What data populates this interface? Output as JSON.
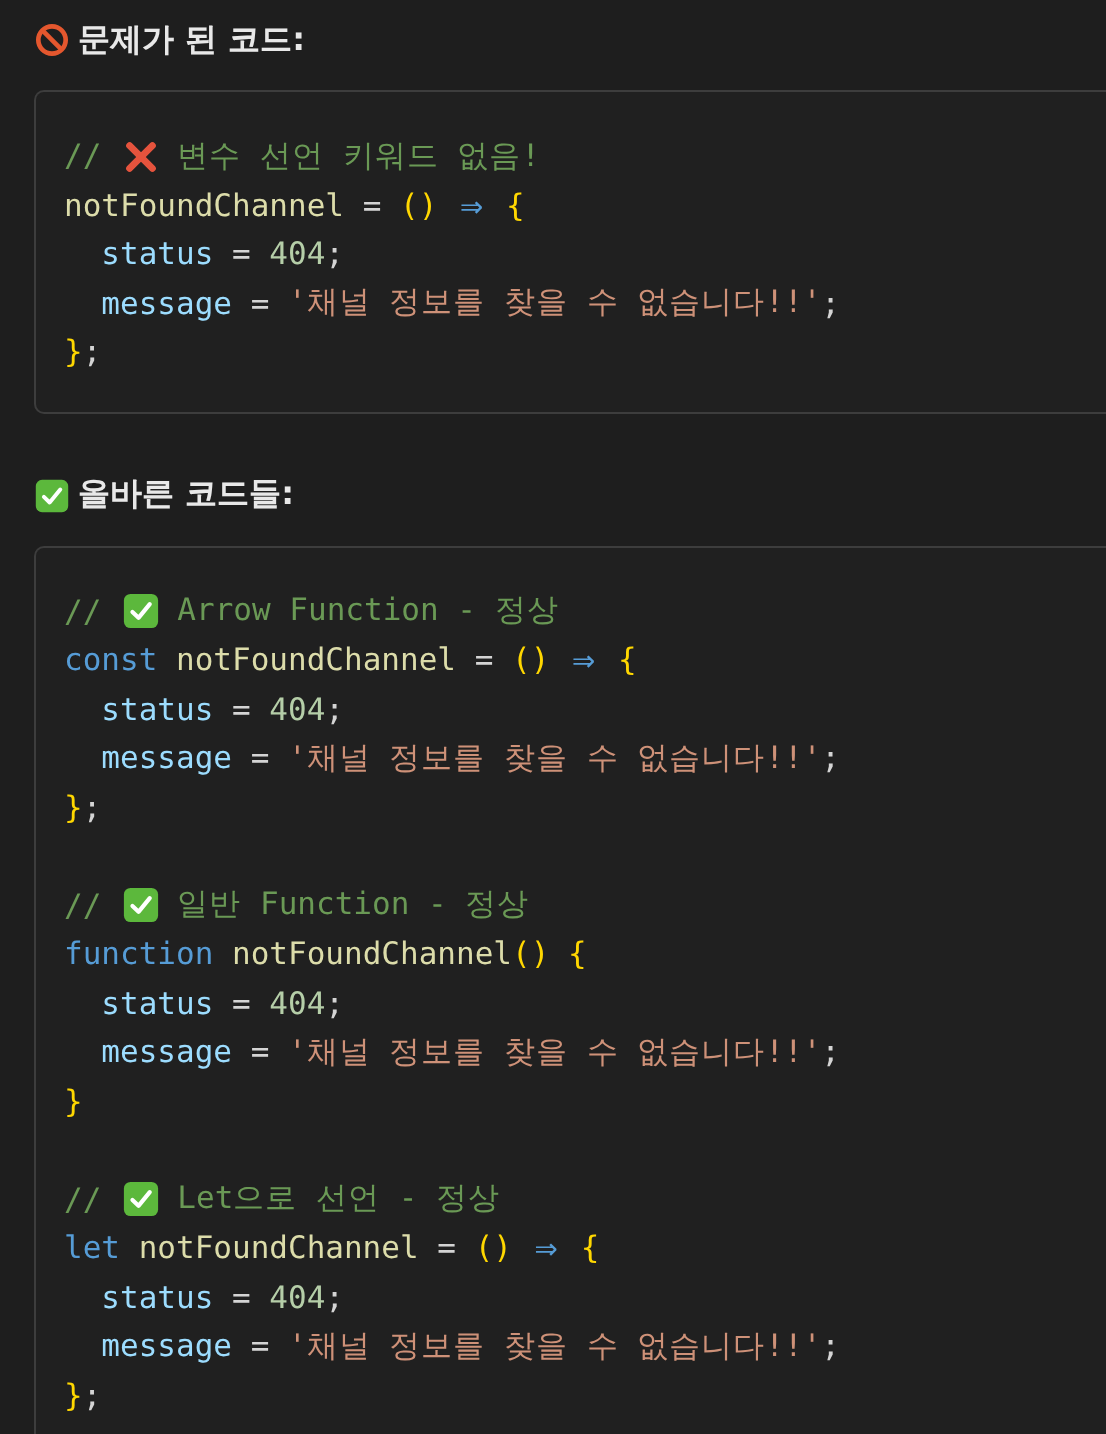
{
  "sections": [
    {
      "heading": {
        "kind": "problem",
        "text": "문제가 된 코드:"
      },
      "snippets": [
        [
          [
            {
              "kind": "comment",
              "text": "//"
            },
            {
              "kind": "cross-mark"
            },
            {
              "kind": "comment",
              "text": "변수 선언 키워드 없음!"
            }
          ],
          [
            {
              "kind": "name",
              "text": "notFoundChannel"
            },
            {
              "kind": "op",
              "text": " = "
            },
            {
              "kind": "paren",
              "text": "()"
            },
            {
              "kind": "arrow",
              "text": " ⇒ "
            },
            {
              "kind": "paren",
              "text": "{"
            }
          ],
          [
            {
              "kind": "prop",
              "text": "  status"
            },
            {
              "kind": "op",
              "text": " = "
            },
            {
              "kind": "num",
              "text": "404"
            },
            {
              "kind": "op",
              "text": ";"
            }
          ],
          [
            {
              "kind": "prop",
              "text": "  message"
            },
            {
              "kind": "op",
              "text": " = "
            },
            {
              "kind": "str",
              "text": "'채널 정보를 찾을 수 없습니다!!'"
            },
            {
              "kind": "op",
              "text": ";"
            }
          ],
          [
            {
              "kind": "paren",
              "text": "}"
            },
            {
              "kind": "op",
              "text": ";"
            }
          ]
        ]
      ]
    },
    {
      "heading": {
        "kind": "solution",
        "text": "올바른 코드들:"
      },
      "snippets": [
        [
          [
            {
              "kind": "comment",
              "text": "//"
            },
            {
              "kind": "check-mark"
            },
            {
              "kind": "comment",
              "text": "Arrow Function - 정상"
            }
          ],
          [
            {
              "kind": "keyword",
              "text": "const "
            },
            {
              "kind": "name",
              "text": "notFoundChannel"
            },
            {
              "kind": "op",
              "text": " = "
            },
            {
              "kind": "paren",
              "text": "()"
            },
            {
              "kind": "arrow",
              "text": " ⇒ "
            },
            {
              "kind": "paren",
              "text": "{"
            }
          ],
          [
            {
              "kind": "prop",
              "text": "  status"
            },
            {
              "kind": "op",
              "text": " = "
            },
            {
              "kind": "num",
              "text": "404"
            },
            {
              "kind": "op",
              "text": ";"
            }
          ],
          [
            {
              "kind": "prop",
              "text": "  message"
            },
            {
              "kind": "op",
              "text": " = "
            },
            {
              "kind": "str",
              "text": "'채널 정보를 찾을 수 없습니다!!'"
            },
            {
              "kind": "op",
              "text": ";"
            }
          ],
          [
            {
              "kind": "paren",
              "text": "}"
            },
            {
              "kind": "op",
              "text": ";"
            }
          ]
        ],
        [
          [
            {
              "kind": "comment",
              "text": "//"
            },
            {
              "kind": "check-mark"
            },
            {
              "kind": "comment",
              "text": "일반 Function - 정상"
            }
          ],
          [
            {
              "kind": "keyword",
              "text": "function "
            },
            {
              "kind": "name",
              "text": "notFoundChannel"
            },
            {
              "kind": "paren",
              "text": "() {"
            }
          ],
          [
            {
              "kind": "prop",
              "text": "  status"
            },
            {
              "kind": "op",
              "text": " = "
            },
            {
              "kind": "num",
              "text": "404"
            },
            {
              "kind": "op",
              "text": ";"
            }
          ],
          [
            {
              "kind": "prop",
              "text": "  message"
            },
            {
              "kind": "op",
              "text": " = "
            },
            {
              "kind": "str",
              "text": "'채널 정보를 찾을 수 없습니다!!'"
            },
            {
              "kind": "op",
              "text": ";"
            }
          ],
          [
            {
              "kind": "paren",
              "text": "}"
            }
          ]
        ],
        [
          [
            {
              "kind": "comment",
              "text": "//"
            },
            {
              "kind": "check-mark"
            },
            {
              "kind": "comment",
              "text": "Let으로 선언 - 정상"
            }
          ],
          [
            {
              "kind": "keyword",
              "text": "let "
            },
            {
              "kind": "name",
              "text": "notFoundChannel"
            },
            {
              "kind": "op",
              "text": " = "
            },
            {
              "kind": "paren",
              "text": "()"
            },
            {
              "kind": "arrow",
              "text": " ⇒ "
            },
            {
              "kind": "paren",
              "text": "{"
            }
          ],
          [
            {
              "kind": "prop",
              "text": "  status"
            },
            {
              "kind": "op",
              "text": " = "
            },
            {
              "kind": "num",
              "text": "404"
            },
            {
              "kind": "op",
              "text": ";"
            }
          ],
          [
            {
              "kind": "prop",
              "text": "  message"
            },
            {
              "kind": "op",
              "text": " = "
            },
            {
              "kind": "str",
              "text": "'채널 정보를 찾을 수 없습니다!!'"
            },
            {
              "kind": "op",
              "text": ";"
            }
          ],
          [
            {
              "kind": "paren",
              "text": "}"
            },
            {
              "kind": "op",
              "text": ";"
            }
          ]
        ]
      ]
    }
  ]
}
